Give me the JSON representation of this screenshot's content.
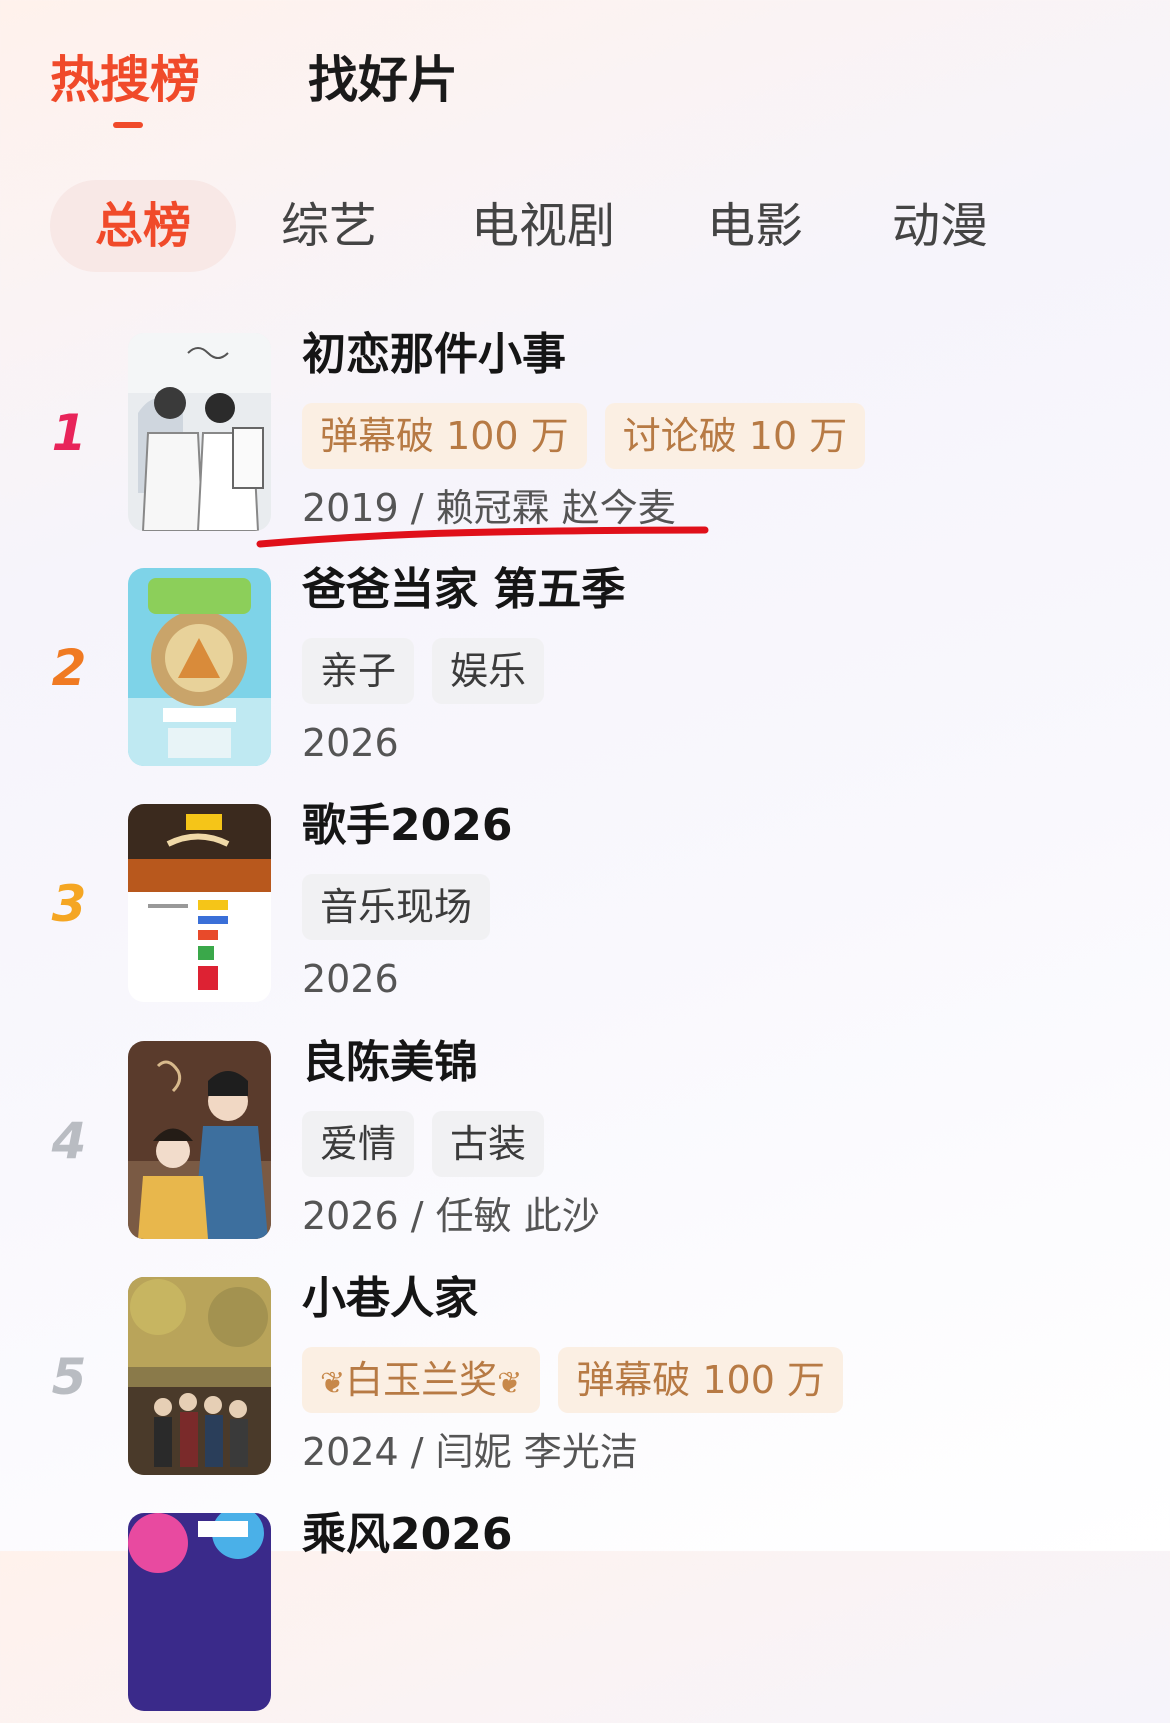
{
  "top_tabs": {
    "active": "热搜榜",
    "other": "找好片"
  },
  "categories": [
    "总榜",
    "综艺",
    "电视剧",
    "电影",
    "动漫"
  ],
  "items": [
    {
      "rank": "1",
      "title": "初恋那件小事",
      "tags": [
        "弹幕破 100 万",
        "讨论破 10 万"
      ],
      "meta": "2019 / 赖冠霖 赵今麦",
      "rank_color": "#e8245a"
    },
    {
      "rank": "2",
      "title": "爸爸当家 第五季",
      "tags": [
        "亲子",
        "娱乐"
      ],
      "meta": "2026",
      "rank_color": "#f07a22"
    },
    {
      "rank": "3",
      "title": "歌手2026",
      "tags": [
        "音乐现场"
      ],
      "meta": "2026",
      "rank_color": "#f5a623"
    },
    {
      "rank": "4",
      "title": "良陈美锦",
      "tags": [
        "爱情",
        "古装"
      ],
      "meta": "2026 / 任敏 此沙",
      "rank_color": "#b9bcc2"
    },
    {
      "rank": "5",
      "title": "小巷人家",
      "tags": [
        "白玉兰奖",
        "弹幕破 100 万"
      ],
      "meta": "2024 / 闫妮 李光洁",
      "rank_color": "#b9bcc2"
    },
    {
      "rank": "",
      "title": "乘风2026",
      "tags": [],
      "meta": ""
    }
  ],
  "colors": {
    "accent": "#f04a2a",
    "tag_orange_bg": "#fbefe3",
    "tag_orange_text": "#b77a44",
    "annotation_red": "#e0101a"
  },
  "poster_icons": [
    "poster-chulian",
    "poster-babadangjia",
    "poster-geshou",
    "poster-liangchen",
    "poster-xiaoxiang",
    "poster-chengfeng"
  ]
}
